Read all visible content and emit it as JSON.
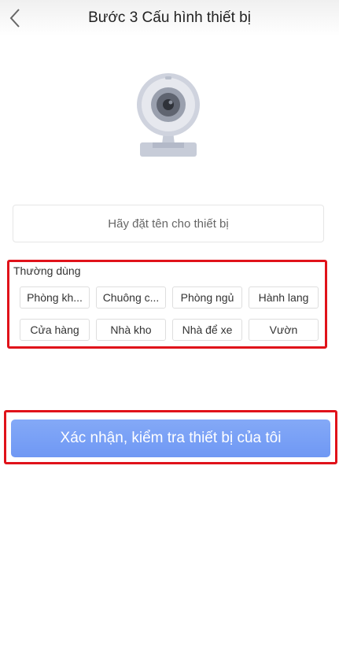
{
  "header": {
    "title": "Bước 3 Cấu hình thiết bị",
    "back_icon": "chevron-left-icon"
  },
  "device_image": {
    "icon": "webcam-icon"
  },
  "name_input": {
    "placeholder": "Hãy đặt tên cho thiết bị",
    "value": ""
  },
  "common": {
    "label": "Thường dùng",
    "chips": [
      "Phòng kh...",
      "Chuông c...",
      "Phòng ngủ",
      "Hành lang",
      "Cửa hàng",
      "Nhà kho",
      "Nhà để xe",
      "Vườn"
    ]
  },
  "confirm_button": {
    "label": "Xác nhận, kiểm tra thiết bị của tôi"
  },
  "colors": {
    "accent": "#6f98f4",
    "highlight": "#e0121a"
  }
}
